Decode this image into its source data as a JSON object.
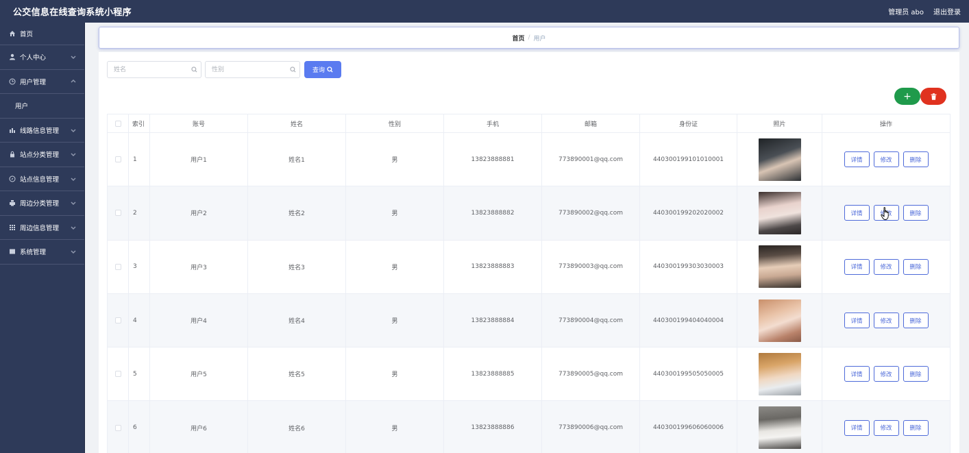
{
  "header": {
    "title": "公交信息在线查询系统小程序",
    "user_label": "管理员 abo",
    "logout_label": "退出登录"
  },
  "sidebar": {
    "items": [
      {
        "label": "首页",
        "icon": "home-icon",
        "has_chevron": false
      },
      {
        "label": "个人中心",
        "icon": "user-icon",
        "has_chevron": true,
        "chevron": "down"
      },
      {
        "label": "用户管理",
        "icon": "clock-icon",
        "has_chevron": true,
        "chevron": "up"
      },
      {
        "label": "用户",
        "icon": "",
        "has_chevron": false,
        "sub": true
      },
      {
        "label": "线路信息管理",
        "icon": "chart-icon",
        "has_chevron": true,
        "chevron": "down"
      },
      {
        "label": "站点分类管理",
        "icon": "lock-icon",
        "has_chevron": true,
        "chevron": "down"
      },
      {
        "label": "站点信息管理",
        "icon": "compass-icon",
        "has_chevron": true,
        "chevron": "down"
      },
      {
        "label": "周边分类管理",
        "icon": "printer-icon",
        "has_chevron": true,
        "chevron": "down"
      },
      {
        "label": "周边信息管理",
        "icon": "grid-icon",
        "has_chevron": true,
        "chevron": "down"
      },
      {
        "label": "系统管理",
        "icon": "list-icon",
        "has_chevron": true,
        "chevron": "down"
      }
    ]
  },
  "breadcrumb": {
    "home": "首页",
    "separator": "/",
    "current": "用户"
  },
  "search": {
    "name_placeholder": "姓名",
    "gender_placeholder": "性别",
    "query_label": "查询"
  },
  "actions": {
    "add_label": "+"
  },
  "table": {
    "columns": [
      "索引",
      "账号",
      "姓名",
      "性别",
      "手机",
      "邮箱",
      "身份证",
      "照片",
      "操作"
    ],
    "op_labels": {
      "detail": "详情",
      "edit": "修改",
      "delete": "删除"
    },
    "rows": [
      {
        "index": "1",
        "account": "用户1",
        "name": "姓名1",
        "gender": "男",
        "phone": "13823888881",
        "email": "773890001@qq.com",
        "id_card": "440300199101010001"
      },
      {
        "index": "2",
        "account": "用户2",
        "name": "姓名2",
        "gender": "男",
        "phone": "13823888882",
        "email": "773890002@qq.com",
        "id_card": "440300199202020002"
      },
      {
        "index": "3",
        "account": "用户3",
        "name": "姓名3",
        "gender": "男",
        "phone": "13823888883",
        "email": "773890003@qq.com",
        "id_card": "440300199303030003"
      },
      {
        "index": "4",
        "account": "用户4",
        "name": "姓名4",
        "gender": "男",
        "phone": "13823888884",
        "email": "773890004@qq.com",
        "id_card": "440300199404040004"
      },
      {
        "index": "5",
        "account": "用户5",
        "name": "姓名5",
        "gender": "男",
        "phone": "13823888885",
        "email": "773890005@qq.com",
        "id_card": "440300199505050005"
      },
      {
        "index": "6",
        "account": "用户6",
        "name": "姓名6",
        "gender": "男",
        "phone": "13823888886",
        "email": "773890006@qq.com",
        "id_card": "440300199606060006"
      }
    ]
  },
  "colors": {
    "sidebar_bg": "#2e3a59",
    "primary": "#5a7bf0",
    "add": "#1f9a4b",
    "delete": "#e0321f"
  }
}
